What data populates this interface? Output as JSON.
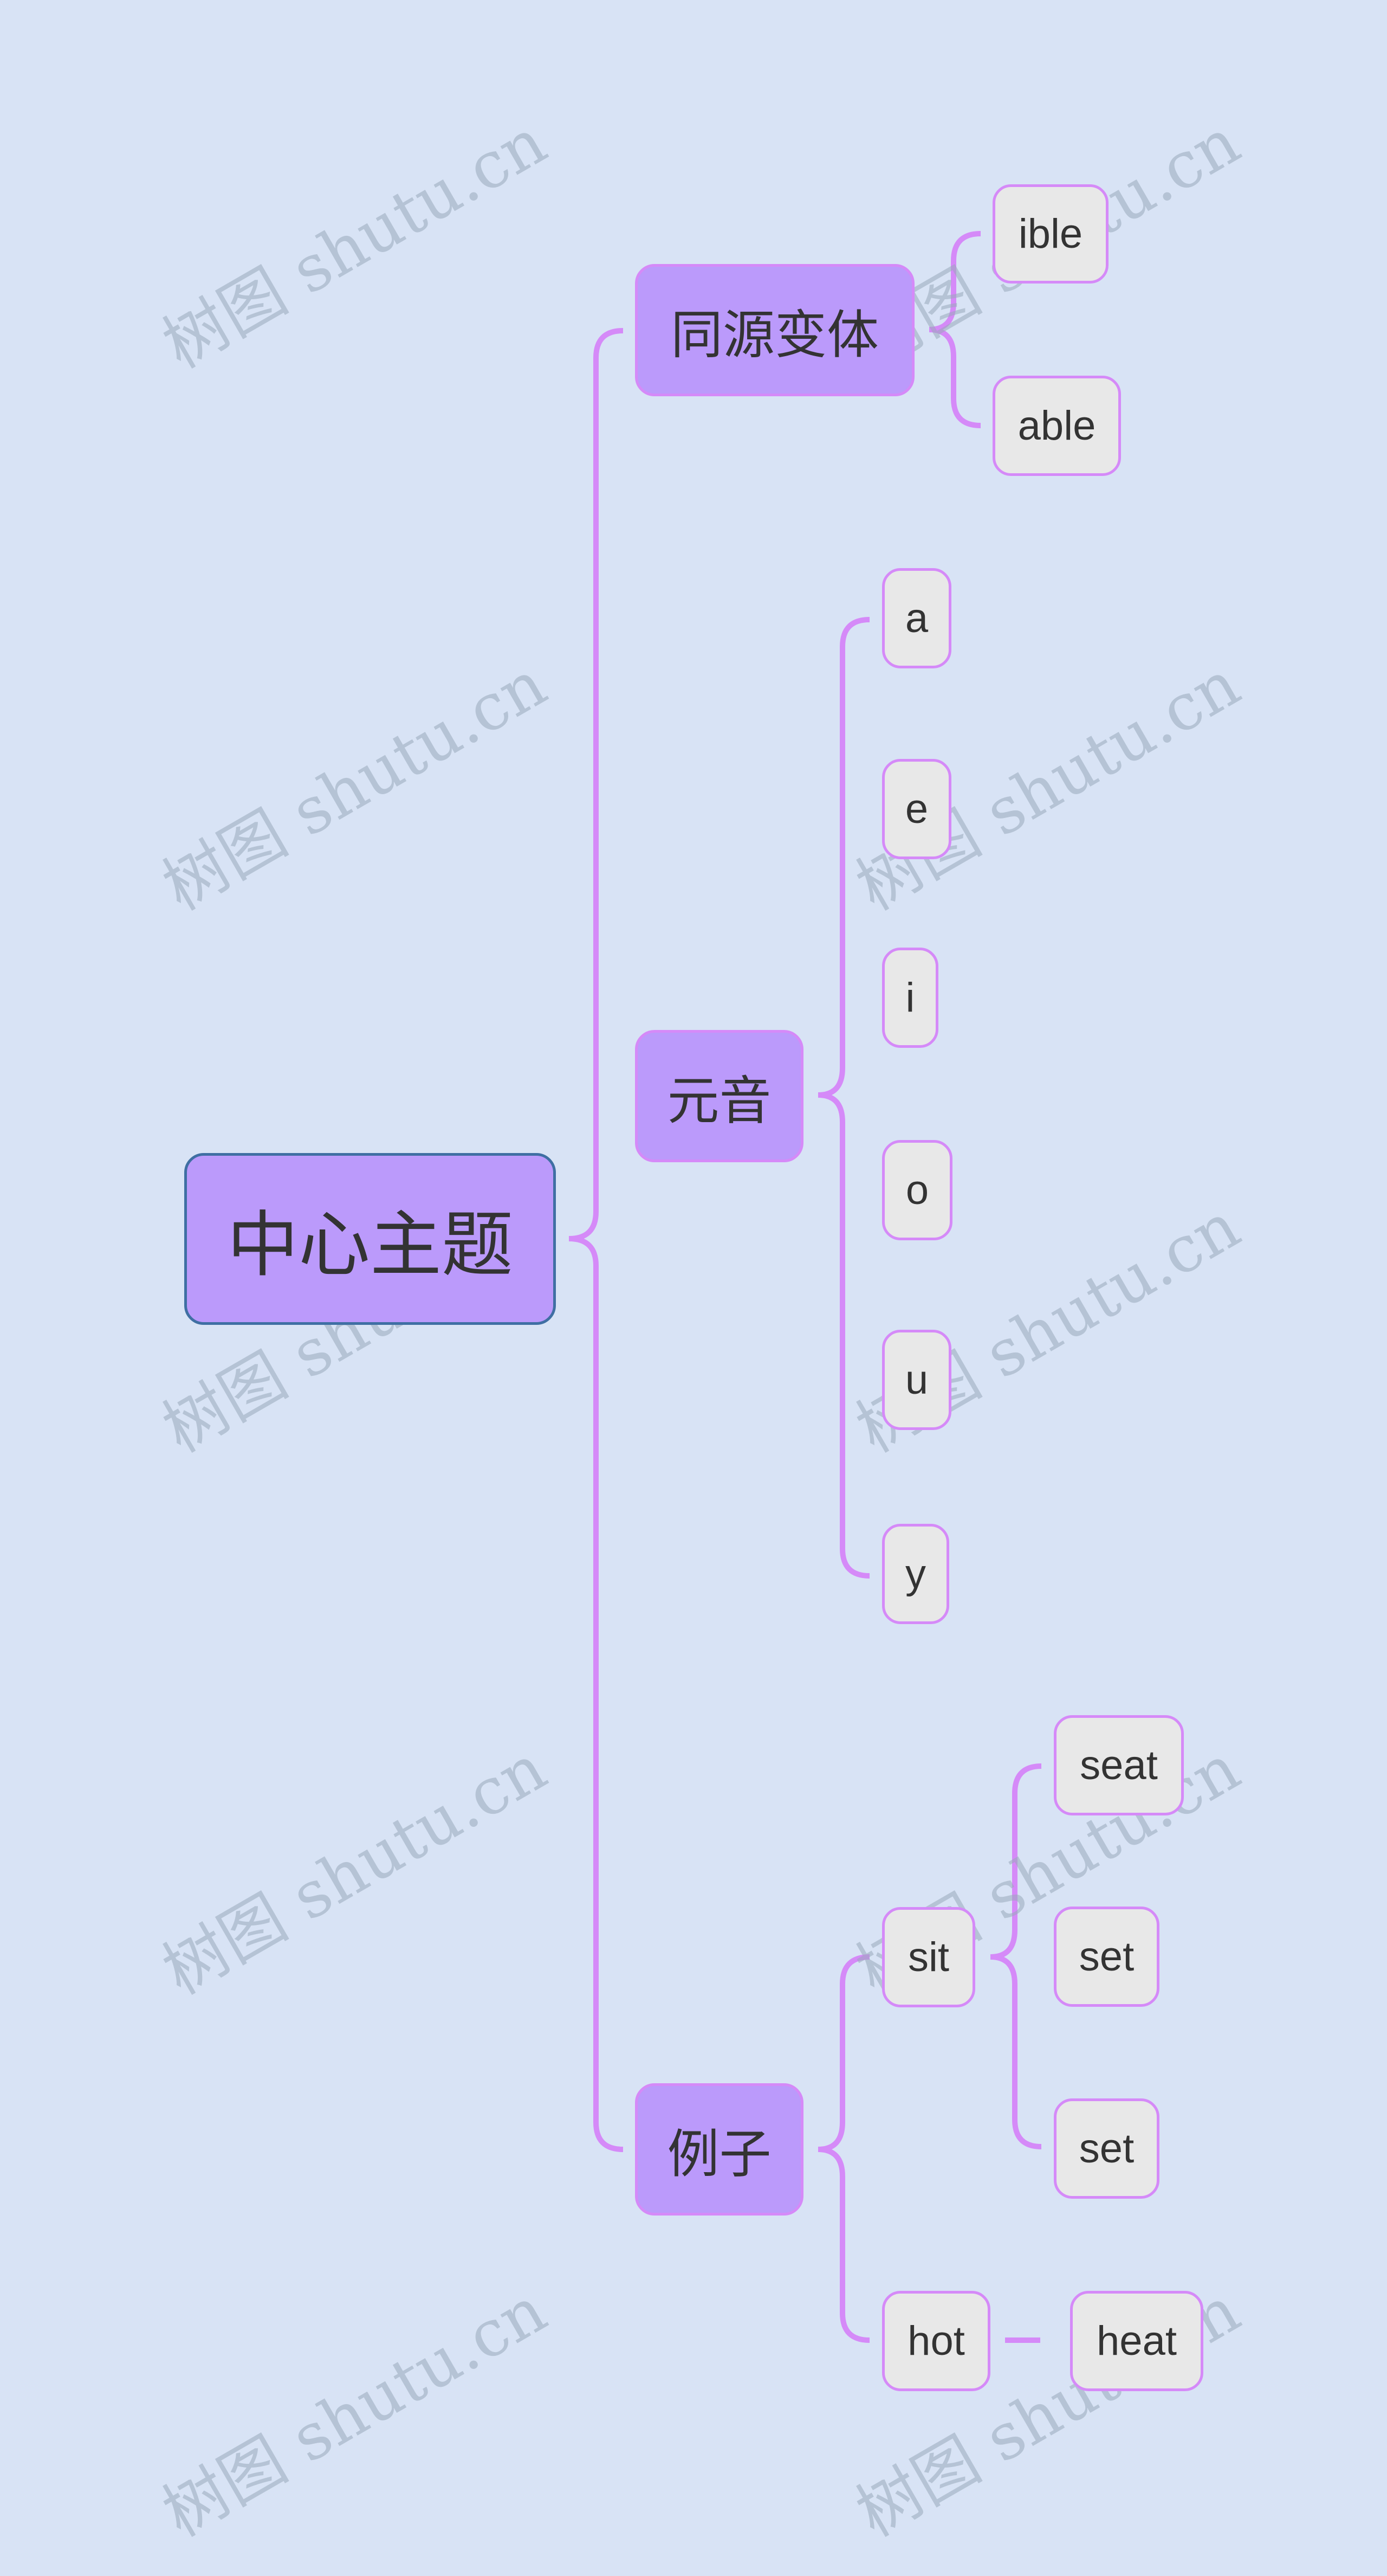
{
  "mindmap": {
    "root": {
      "label": "中心主题"
    },
    "branches": [
      {
        "label": "同源变体",
        "children": [
          {
            "label": "ible"
          },
          {
            "label": "able"
          }
        ]
      },
      {
        "label": "元音",
        "children": [
          {
            "label": "a"
          },
          {
            "label": "e"
          },
          {
            "label": "i"
          },
          {
            "label": "o"
          },
          {
            "label": "u"
          },
          {
            "label": "y"
          }
        ]
      },
      {
        "label": "例子",
        "children": [
          {
            "label": "sit",
            "children": [
              {
                "label": "seat"
              },
              {
                "label": "set"
              },
              {
                "label": "set"
              }
            ]
          },
          {
            "label": "hot",
            "children": [
              {
                "label": "heat"
              }
            ]
          }
        ]
      }
    ]
  },
  "colors": {
    "background": "#D8E3F5",
    "node_fill": "#BB9AFB",
    "leaf_fill": "#E8E8E8",
    "connector": "#D58AF8",
    "root_border": "#3F6FA3"
  },
  "watermark": {
    "text": "树图 shutu.cn"
  }
}
